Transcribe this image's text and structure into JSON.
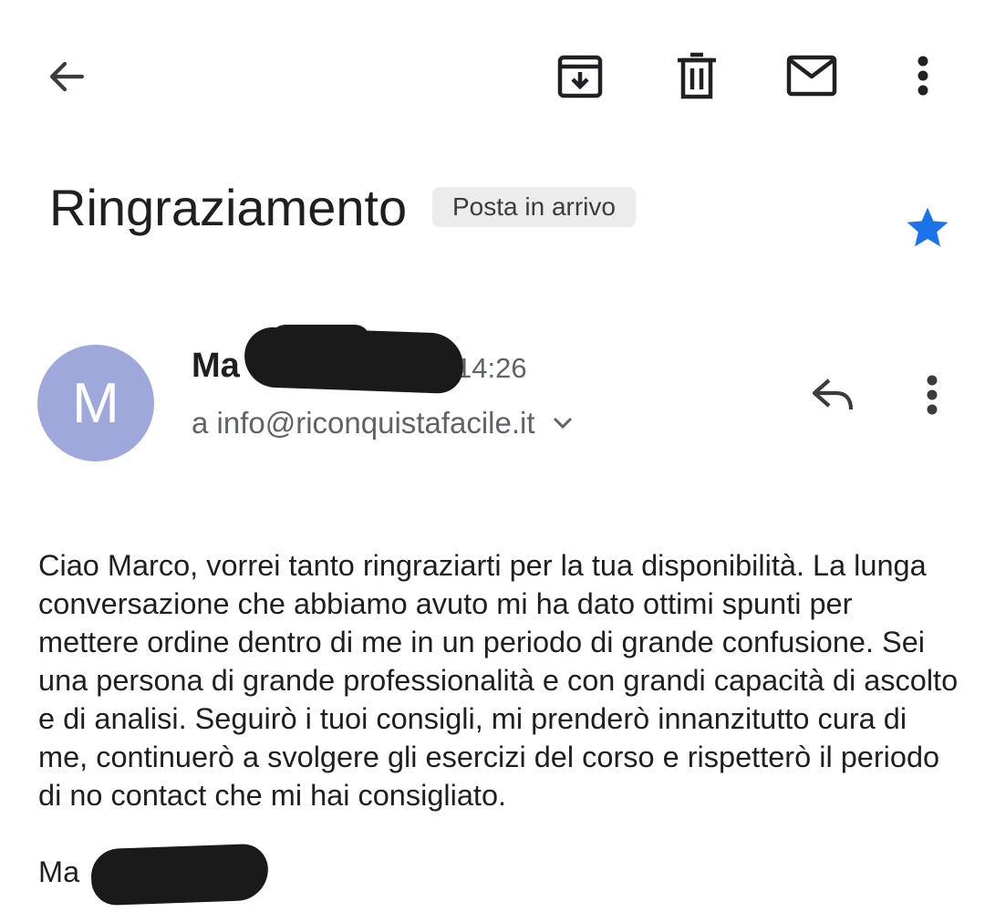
{
  "toolbar": {
    "back_icon": "arrow-left-icon",
    "archive_icon": "archive-icon",
    "delete_icon": "trash-icon",
    "mark_unread_icon": "envelope-icon",
    "more_icon": "more-vert-icon"
  },
  "email": {
    "subject": "Ringraziamento",
    "label": "Posta in arrivo",
    "starred": true,
    "star_color": "#1a73e8",
    "avatar_letter": "M",
    "avatar_color": "#9fa8da",
    "sender_name_visible": "Ma",
    "time": "14:26",
    "recipient": "a info@riconquistafacile.it",
    "body": "Ciao Marco, vorrei tanto ringraziarti per la tua disponibilità. La lunga conversazione che abbiamo avuto mi ha dato ottimi spunti per mettere ordine dentro di me in un periodo di grande confusione. Sei una persona di grande professionalità e con grandi capacità di ascolto e di analisi. Seguirò i tuoi consigli, mi prenderò innanzitutto cura di me, continuerò a svolgere gli esercizi del corso e rispetterò il periodo di no contact che mi hai consigliato.",
    "signature_visible": "Ma"
  }
}
